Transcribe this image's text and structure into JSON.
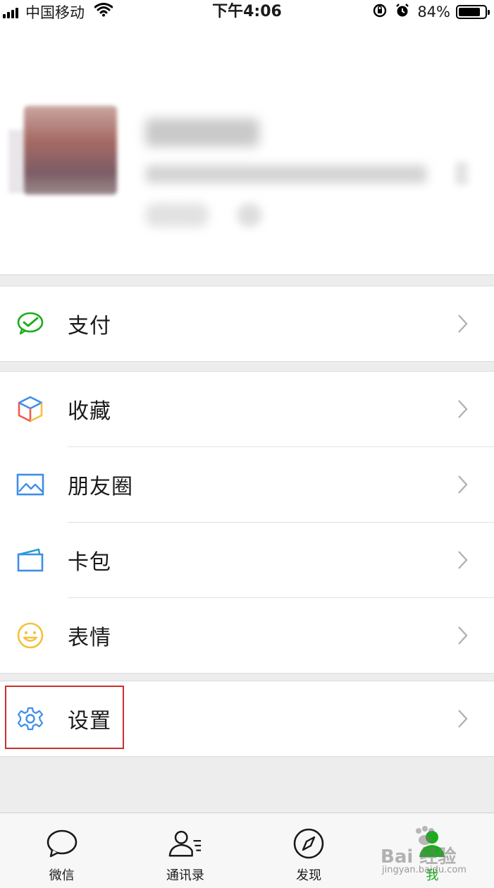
{
  "status_bar": {
    "carrier": "中国移动",
    "time": "下午4:06",
    "battery_percent": "84%",
    "battery_level": 0.84
  },
  "menu": {
    "pay": "支付",
    "favorites": "收藏",
    "moments": "朋友圈",
    "cards": "卡包",
    "stickers": "表情",
    "settings": "设置"
  },
  "tabs": [
    {
      "label": "微信",
      "icon": "chat-icon"
    },
    {
      "label": "通讯录",
      "icon": "contacts-icon"
    },
    {
      "label": "发现",
      "icon": "compass-icon"
    },
    {
      "label": "我",
      "icon": "me-icon"
    }
  ],
  "active_tab": "我",
  "watermark": {
    "main": "Bai 经验",
    "sub": "jingyan.baidu.com"
  },
  "colors": {
    "accent_green": "#1aad19",
    "highlight_red": "#c9302c",
    "background": "#ededed"
  }
}
